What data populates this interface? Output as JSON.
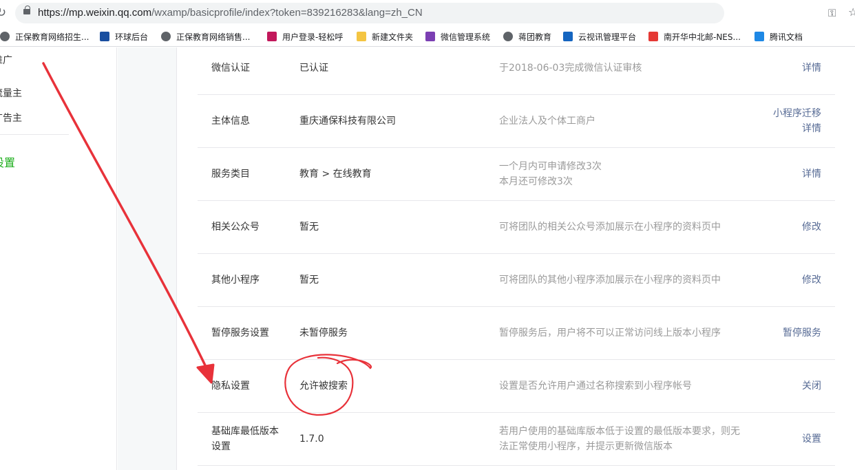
{
  "browser": {
    "url_host": "https://mp.weixin.qq.com",
    "url_path": "/wxamp/basicprofile/index?token=839216283&lang=zh_CN",
    "bookmarks": [
      {
        "label": "正保教育网络招生...",
        "color": "#5f6368"
      },
      {
        "label": "环球后台",
        "color": "#1a4fa0"
      },
      {
        "label": "正保教育网络销售...",
        "color": "#5f6368"
      },
      {
        "label": "用户登录-轻松呼",
        "color": "#c2185b"
      },
      {
        "label": "新建文件夹",
        "color": "#f4c542"
      },
      {
        "label": "微信管理系统",
        "color": "#7b3fb3"
      },
      {
        "label": "蒋团教育",
        "color": "#5f6368"
      },
      {
        "label": "云视讯管理平台",
        "color": "#1565c0"
      },
      {
        "label": "南开华中北邮-NES...",
        "color": "#e53935"
      },
      {
        "label": "腾讯文档",
        "color": "#1e88e5"
      }
    ]
  },
  "leftnav": {
    "items": [
      "推广",
      "流量主",
      "广告主"
    ],
    "active": "设置"
  },
  "settings_rows": [
    {
      "label": "微信认证",
      "value": "已认证",
      "desc": [
        "于2018-06-03完成微信认证审核"
      ],
      "actions": [
        "详情"
      ]
    },
    {
      "label": "主体信息",
      "value": "重庆通保科技有限公司",
      "desc": [
        "企业法人及个体工商户"
      ],
      "actions": [
        "小程序迁移",
        "详情"
      ]
    },
    {
      "label": "服务类目",
      "value": "教育 > 在线教育",
      "desc": [
        "一个月内可申请修改3次",
        "本月还可修改3次"
      ],
      "actions": [
        "详情"
      ]
    },
    {
      "label": "相关公众号",
      "value": "暂无",
      "desc": [
        "可将团队的相关公众号添加展示在小程序的资料页中"
      ],
      "actions": [
        "修改"
      ]
    },
    {
      "label": "其他小程序",
      "value": "暂无",
      "desc": [
        "可将团队的其他小程序添加展示在小程序的资料页中"
      ],
      "actions": [
        "修改"
      ]
    },
    {
      "label": "暂停服务设置",
      "value": "未暂停服务",
      "desc": [
        "暂停服务后，用户将不可以正常访问线上版本小程序"
      ],
      "actions": [
        "暂停服务"
      ]
    },
    {
      "label": "隐私设置",
      "value": "允许被搜索",
      "desc": [
        "设置是否允许用户通过名称搜索到小程序帐号"
      ],
      "actions": [
        "关闭"
      ]
    },
    {
      "label": "基础库最低版本设置",
      "value": "1.7.0",
      "desc": [
        "若用户使用的基础库版本低于设置的最低版本要求，则无法正常使用小程序，并提示更新微信版本"
      ],
      "actions": [
        "设置"
      ]
    }
  ],
  "colors": {
    "link": "#576b95",
    "active_nav": "#1aad19",
    "annotation": "#e8323a"
  }
}
